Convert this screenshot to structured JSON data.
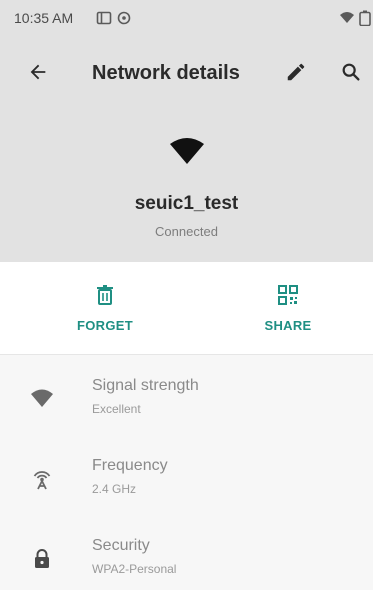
{
  "status_bar": {
    "time": "10:35 AM",
    "icons": [
      "notification-card-icon",
      "sync-icon",
      "wifi-icon",
      "battery-icon"
    ]
  },
  "app_bar": {
    "title": "Network details",
    "back_icon": "arrow-left-icon",
    "edit_icon": "pencil-icon",
    "search_icon": "search-icon"
  },
  "network": {
    "name": "seuic1_test",
    "status": "Connected",
    "icon": "wifi-icon"
  },
  "actions": [
    {
      "label": "FORGET",
      "icon": "trash-icon"
    },
    {
      "label": "SHARE",
      "icon": "qr-code-icon"
    }
  ],
  "details": [
    {
      "title": "Signal strength",
      "value": "Excellent",
      "icon": "wifi-icon"
    },
    {
      "title": "Frequency",
      "value": "2.4 GHz",
      "icon": "antenna-icon"
    },
    {
      "title": "Security",
      "value": "WPA2-Personal",
      "icon": "lock-icon"
    }
  ],
  "colors": {
    "header_bg": "#e2e2e2",
    "accent": "#1f8f83",
    "list_bg": "#f7f7f7",
    "text_primary": "#2b2b2b",
    "text_secondary": "#8a8a8a"
  }
}
